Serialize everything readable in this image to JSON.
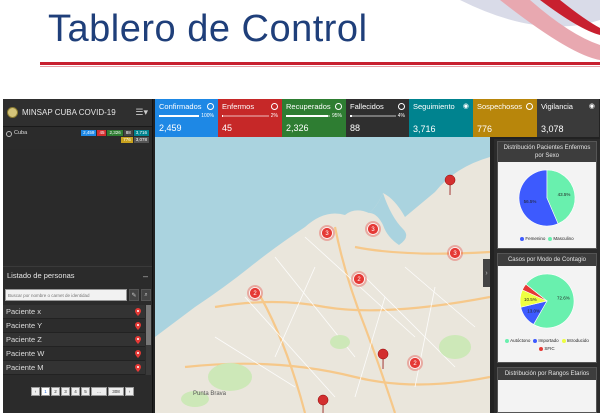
{
  "slide_title": "Tablero de Control",
  "app": {
    "title": "MINSAP CUBA COVID-19"
  },
  "country_row": {
    "label": "Cuba",
    "chips": [
      {
        "value": "2,459",
        "color": "#1e88e5"
      },
      {
        "value": "45",
        "color": "#d32f2f"
      },
      {
        "value": "2,326",
        "color": "#2e7d32"
      },
      {
        "value": "88",
        "color": "#444444"
      },
      {
        "value": "3,716",
        "color": "#00838f"
      },
      {
        "value": "776",
        "color": "#c8a21e"
      },
      {
        "value": "3,078",
        "color": "#555555"
      }
    ]
  },
  "kpis": [
    {
      "name": "Confirmados",
      "pct": "100%",
      "pct_value": 1.0,
      "value": "2,459",
      "color": "#1e88e5",
      "icon": "check-circle-icon"
    },
    {
      "name": "Enfermos",
      "pct": "2%",
      "pct_value": 0.02,
      "value": "45",
      "color": "#c62828",
      "icon": "circle-icon"
    },
    {
      "name": "Recuperados",
      "pct": "95%",
      "pct_value": 0.95,
      "value": "2,326",
      "color": "#2e7d32",
      "icon": "circle-icon"
    },
    {
      "name": "Fallecidos",
      "pct": "4%",
      "pct_value": 0.04,
      "value": "88",
      "color": "#2f2f2f",
      "icon": "circle-icon"
    },
    {
      "name": "Seguimiento",
      "pct": "",
      "pct_value": null,
      "value": "3,716",
      "color": "#00838f",
      "icon": "eye-icon"
    },
    {
      "name": "Sospechosos",
      "pct": "",
      "pct_value": null,
      "value": "776",
      "color": "#b8860b",
      "icon": "circle-icon"
    },
    {
      "name": "Vigilancia",
      "pct": "",
      "pct_value": null,
      "value": "3,078",
      "color": "#3a3a3a",
      "icon": "eye-icon"
    }
  ],
  "persons": {
    "title": "Listado de personas",
    "search_placeholder": "Buscar por nombre o carnet de identidad",
    "items": [
      "Paciente x",
      "Paciente Y",
      "Paciente Z",
      "Paciente W",
      "Paciente M"
    ],
    "pages": [
      "‹",
      "1",
      "2",
      "3",
      "4",
      "5",
      "...",
      "308",
      "›"
    ]
  },
  "map": {
    "place_labels": [
      "Punta Brava"
    ],
    "clusters": [
      "3",
      "3",
      "2",
      "3",
      "2",
      "2"
    ]
  },
  "charts": [
    {
      "title": "Distribución Pacientes Enfermos por Sexo",
      "chart_data": {
        "type": "pie",
        "categories": [
          "Femenino",
          "Masculino"
        ],
        "values": [
          56.5,
          43.5
        ],
        "colors": [
          "#3d5afe",
          "#69f0ae"
        ],
        "data_labels": [
          "56.5%",
          "43.5%"
        ],
        "legend": "bottom"
      }
    },
    {
      "title": "Casos por Modo de Contagio",
      "chart_data": {
        "type": "pie",
        "categories": [
          "Autóctono",
          "Importado",
          "Introducido",
          "SFIC"
        ],
        "values": [
          72.6,
          13.0,
          10.5,
          3.9
        ],
        "colors": [
          "#69f0ae",
          "#3d5afe",
          "#eeff41",
          "#e53935"
        ],
        "data_labels": [
          "72.6%",
          "13.0%",
          "10.5%",
          ""
        ],
        "legend": "bottom"
      }
    },
    {
      "title": "Distribución por Rangos Etarios"
    }
  ]
}
